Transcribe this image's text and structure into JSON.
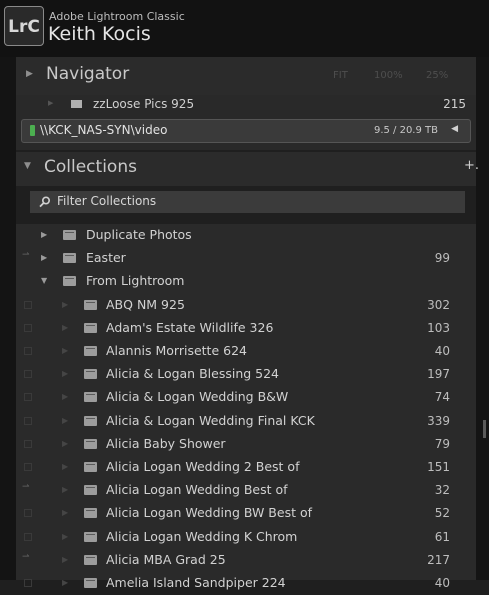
{
  "titlebar": {
    "logo": "LrC",
    "app_title": "Adobe Lightroom Classic",
    "user": "Keith Kocis"
  },
  "navigator": {
    "title": "Navigator",
    "zoom": [
      "FIT",
      "100%",
      "25%"
    ]
  },
  "folders": {
    "row": {
      "label": "zzLoose Pics 925",
      "count": "215"
    },
    "volume": {
      "name": "\\\\KCK_NAS-SYN\\video",
      "size": "9.5 / 20.9 TB"
    }
  },
  "collections": {
    "title": "Collections",
    "add": "+.",
    "filter": "Filter Collections",
    "items": [
      {
        "label": "Duplicate Photos",
        "count": "",
        "level": 0,
        "open": false,
        "mark": ""
      },
      {
        "label": "Easter",
        "count": "99",
        "level": 0,
        "open": false,
        "mark": "arrow"
      },
      {
        "label": "From Lightroom",
        "count": "",
        "level": 0,
        "open": true,
        "mark": ""
      },
      {
        "label": "ABQ NM 925",
        "count": "302",
        "level": 1,
        "mark": "box"
      },
      {
        "label": "Adam's Estate Wildlife 326",
        "count": "103",
        "level": 1,
        "mark": "box"
      },
      {
        "label": "Alannis Morrisette 624",
        "count": "40",
        "level": 1,
        "mark": "box"
      },
      {
        "label": "Alicia & Logan Blessing 524",
        "count": "197",
        "level": 1,
        "mark": "box"
      },
      {
        "label": "Alicia & Logan Wedding B&W",
        "count": "74",
        "level": 1,
        "mark": "box"
      },
      {
        "label": "Alicia & Logan Wedding Final KCK",
        "count": "339",
        "level": 1,
        "mark": "box"
      },
      {
        "label": "Alicia Baby Shower",
        "count": "79",
        "level": 1,
        "mark": "box"
      },
      {
        "label": "Alicia Logan Wedding 2 Best of",
        "count": "151",
        "level": 1,
        "mark": "box"
      },
      {
        "label": "Alicia Logan Wedding Best of",
        "count": "32",
        "level": 1,
        "mark": "arrow"
      },
      {
        "label": "Alicia Logan Wedding BW Best of",
        "count": "52",
        "level": 1,
        "mark": "box"
      },
      {
        "label": "Alicia Logan Wedding K Chrom",
        "count": "61",
        "level": 1,
        "mark": "box"
      },
      {
        "label": "Alicia MBA Grad 25",
        "count": "217",
        "level": 1,
        "mark": "arrow"
      },
      {
        "label": "Amelia Island Sandpiper 224",
        "count": "40",
        "level": 1,
        "mark": "box"
      }
    ]
  }
}
